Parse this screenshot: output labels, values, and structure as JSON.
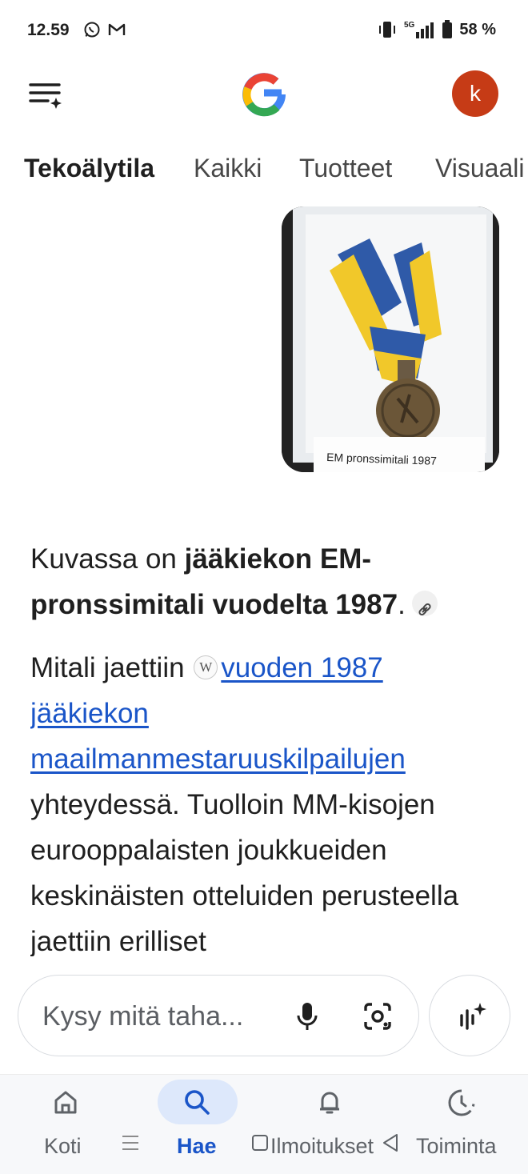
{
  "status_bar": {
    "time": "12.59",
    "battery_percent": "58 %",
    "network": "5G"
  },
  "header": {
    "logo": "google-logo",
    "avatar_letter": "k",
    "avatar_color": "#c63b16"
  },
  "tabs": [
    {
      "label": "Tekoälytila",
      "active": true
    },
    {
      "label": "Kaikki",
      "active": false
    },
    {
      "label": "Tuotteet",
      "active": false
    },
    {
      "label": "Visuaali",
      "active": false
    }
  ],
  "image_card": {
    "caption": "EM pronssimitali 1987"
  },
  "answer": {
    "p1_plain": "Kuvassa on ",
    "p1_bold": "jääkiekon EM-pronssimitali vuodelta 1987",
    "p1_end": ".",
    "p2_start": "Mitali jaettiin ",
    "p2_link": "vuoden 1987 jääkiekon maailmanmestaruuskilpailujen",
    "p2_rest": " yhteydessä. Tuolloin MM-kisojen eurooppalaisten joukkueiden keskinäisten otteluiden perusteella jaettiin erilliset"
  },
  "search": {
    "placeholder": "Kysy mitä taha..."
  },
  "bottom_nav": {
    "items": [
      {
        "label": "Koti",
        "icon": "home-icon"
      },
      {
        "label": "Hae",
        "icon": "search-icon",
        "active": true
      },
      {
        "label": "Ilmoitukset",
        "icon": "bell-icon"
      },
      {
        "label": "Toiminta",
        "icon": "activity-icon"
      }
    ]
  },
  "colors": {
    "link": "#1a55c8",
    "active_nav": "#1a55c8",
    "nav_pill": "#dde8fb"
  }
}
